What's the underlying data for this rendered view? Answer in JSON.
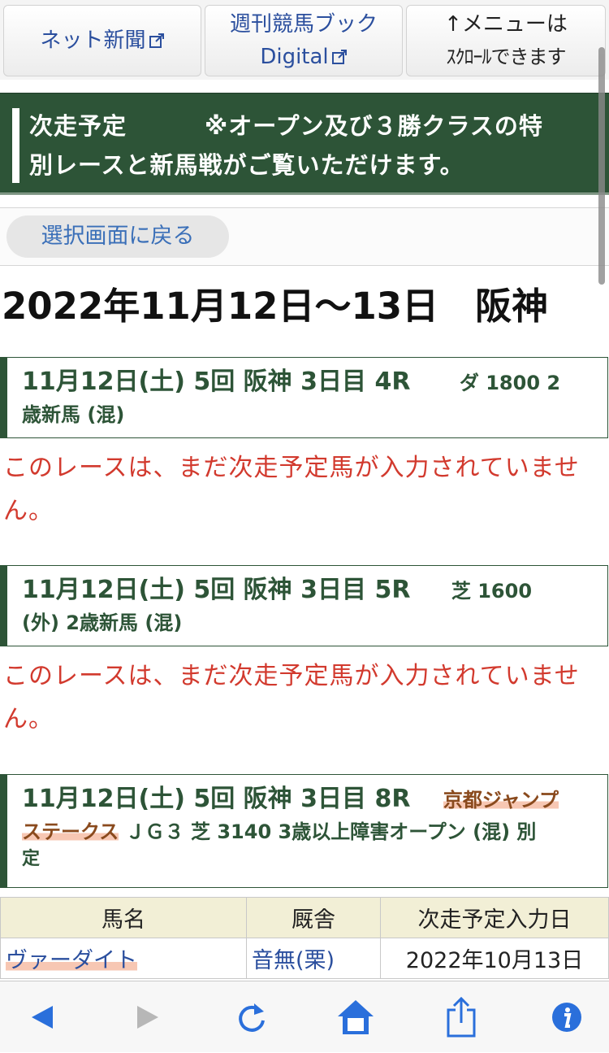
{
  "nav": {
    "net_news": "ネット新聞",
    "weekly_line1": "週刊競馬ブック",
    "weekly_line2": "Digital",
    "menu_line1": "↑メニューは",
    "menu_line2": "ｽｸﾛｰﾙできます"
  },
  "section": {
    "title": "次走予定",
    "note_line1": "※オープン及び３勝クラスの特",
    "note_line2": "別レースと新馬戦がご覧いただけます。"
  },
  "back_button": "選択画面に戻る",
  "date_header": "2022年11月12日〜13日　阪神",
  "races": [
    {
      "line1": "11月12日(土) 5回 阪神 3日目 4R",
      "course": "ダ 1800 2",
      "line2": "歳新馬 (混)",
      "notice_line1": "このレースは、まだ次走予定馬が入力されていませ",
      "notice_line2": "ん。"
    },
    {
      "line1": "11月12日(土) 5回 阪神 3日目 5R",
      "course": "芝 1600",
      "line2": "(外) 2歳新馬 (混)",
      "notice_line1": "このレースは、まだ次走予定馬が入力されていませ",
      "notice_line2": "ん。"
    },
    {
      "line1": "11月12日(土) 5回 阪神 3日目 8R",
      "race_name_a": "京都ジャンプ",
      "race_name_b": "ステークス",
      "line2_rest": " ＪＧ３ 芝 3140 3歳以上障害オープン (混) 別",
      "line3": "定"
    }
  ],
  "table": {
    "headers": [
      "馬名",
      "厩舎",
      "次走予定入力日"
    ],
    "rows": [
      {
        "horse": "ヴァーダイト",
        "stable": "音無(栗)",
        "date": "2022年10月13日"
      }
    ]
  },
  "toolbar": {
    "icons": [
      "back-arrow-icon",
      "forward-arrow-icon",
      "reload-icon",
      "home-icon",
      "share-icon",
      "info-icon"
    ],
    "accent": "#2a6fdb",
    "disabled": "#b7b7b7"
  },
  "colors": {
    "green": "#2d5437",
    "link": "#2b4f9e",
    "notice": "#d23a2e",
    "table_header": "#f2efd6",
    "highlight": "#f7c7b3"
  }
}
